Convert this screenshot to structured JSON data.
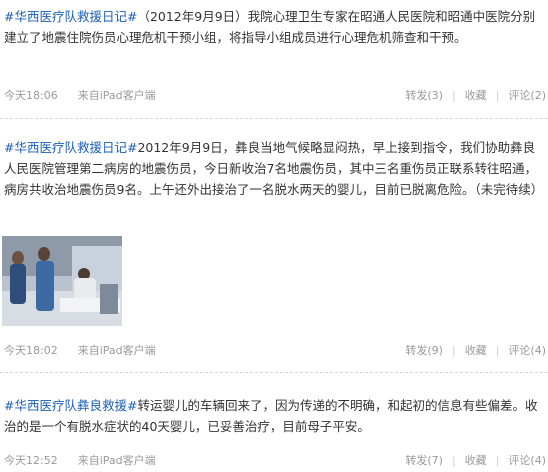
{
  "posts": [
    {
      "tag": "#华西医疗队救援日记#",
      "body": "（2012年9月9日）我院心理卫生专家在昭通人民医院和昭通中医院分别建立了地震住院伤员心理危机干预小组，将指导小组成员进行心理危机筛查和干预。",
      "time": "今天18:06",
      "source": "来自iPad客户端",
      "repost": "转发(3)",
      "favorite": "收藏",
      "comment": "评论(2)"
    },
    {
      "tag": "#华西医疗队救援日记#",
      "body": "2012年9月9日，彝良当地气候略显闷热，早上接到指令，我们协助彝良人民医院管理第二病房的地震伤员，今日新收治7名地震伤员，其中三名重伤员正联系转往昭通，病房共收治地震伤员9名。上午还外出接治了一名脱水两天的婴儿，目前已脱离危险。（未完待续）",
      "time": "今天18:02",
      "source": "来自iPad客户端",
      "repost": "转发(9)",
      "favorite": "收藏",
      "comment": "评论(4)"
    },
    {
      "tag": "#华西医疗队彝良救援#",
      "body": "转运婴儿的车辆回来了，因为传递的不明确，和起初的信息有些偏差。收治的是一个有脱水症状的40天婴儿，已妥善治疗，目前母子平安。",
      "time": "今天12:52",
      "source": "来自iPad客户端",
      "repost": "转发(7)",
      "favorite": "收藏",
      "comment": "评论(4)"
    }
  ],
  "colors": {
    "tag": "#1a5fb4",
    "meta": "#9a9a9a",
    "body": "#333333"
  }
}
